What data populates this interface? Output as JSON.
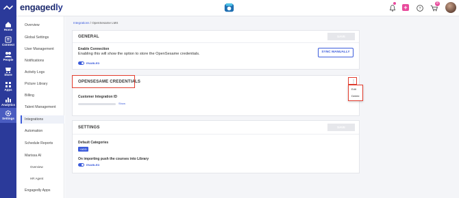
{
  "header": {
    "logo_main": "engaged",
    "logo_suffix": "ly",
    "notification_badge": "8",
    "add_label": "+"
  },
  "rail": {
    "items": [
      {
        "label": "Home"
      },
      {
        "label": "Connect"
      },
      {
        "label": "People"
      },
      {
        "label": "Store"
      },
      {
        "label": "Apps"
      },
      {
        "label": "Analytics"
      },
      {
        "label": "Settings"
      }
    ]
  },
  "sidebar": {
    "items": [
      {
        "label": "Overview"
      },
      {
        "label": "Global Settings"
      },
      {
        "label": "User Management"
      },
      {
        "label": "Notifications"
      },
      {
        "label": "Activity Logs"
      },
      {
        "label": "Picture Library"
      },
      {
        "label": "Billing"
      },
      {
        "label": "Talent Management"
      },
      {
        "label": "Integrations"
      },
      {
        "label": "Automation"
      },
      {
        "label": "Schedule Reports"
      },
      {
        "label": "Marissa AI"
      },
      {
        "label": "Overview"
      },
      {
        "label": "HR Agent"
      },
      {
        "label": "Engagedly Apps"
      }
    ]
  },
  "breadcrumb": {
    "link": "Integrations",
    "sep": "/",
    "current": "OpenSesame LMS"
  },
  "general": {
    "title": "GENERAL",
    "save_label": "SAVE",
    "enable_label": "Enable Connection",
    "description": "Enabling this will show the option to store the OpenSesame credentials.",
    "toggle_label": "ENABLED",
    "sync_label": "SYNC MANUALLY"
  },
  "credentials": {
    "title": "OPENSESAME CREDENTIALS",
    "field_label": "Customer Integration ID",
    "show_label": "Show",
    "menu": {
      "dots": "⋮",
      "edit": "Edit",
      "delete": "Delete"
    }
  },
  "settings": {
    "title": "SETTINGS",
    "save_label": "SAVE",
    "categories_label": "Default Categories",
    "chip_label": "+ADD",
    "push_label": "On importing push the courses into Library",
    "toggle_label": "ENABLED"
  },
  "colors": {
    "brand": "#2b3a9a",
    "accent": "#3b5bdb",
    "highlight": "#e23b2c"
  }
}
